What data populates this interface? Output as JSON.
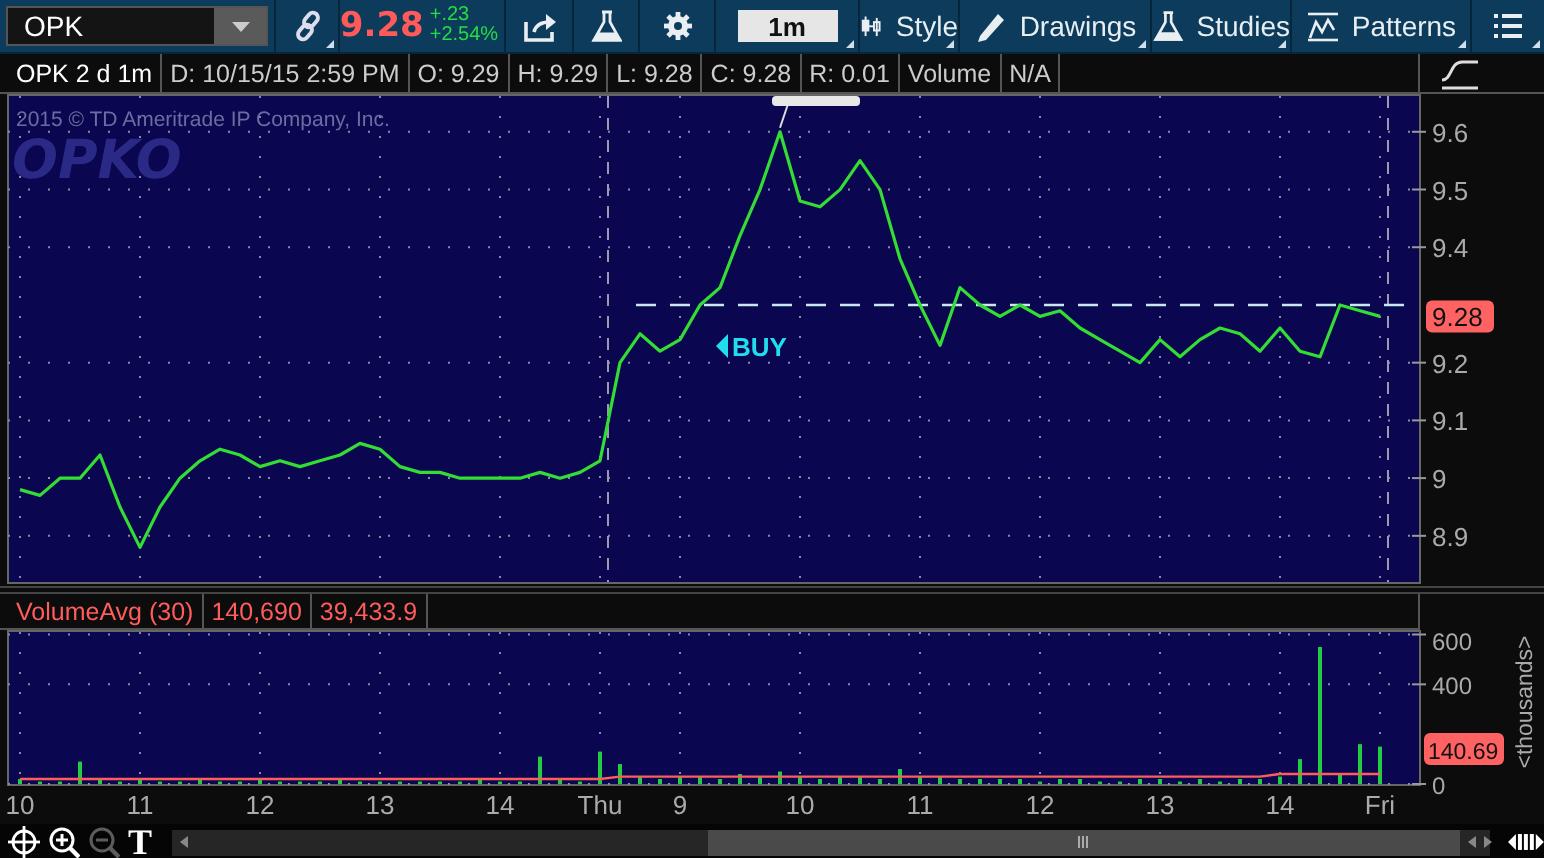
{
  "toolbar": {
    "symbol": "OPK",
    "last_price": "9.28",
    "change": "+.23",
    "change_percent": "+2.54%",
    "timeframe": "1m",
    "menus": [
      {
        "kind": "style",
        "label": "Style"
      },
      {
        "kind": "drawings",
        "label": "Drawings"
      },
      {
        "kind": "studies",
        "label": "Studies"
      },
      {
        "kind": "patterns",
        "label": "Patterns"
      }
    ]
  },
  "info_bar": {
    "cells": [
      "OPK 2 d 1m",
      "D: 10/15/15 2:59 PM",
      "O: 9.29",
      "H: 9.29",
      "L: 9.28",
      "C: 9.28",
      "R: 0.01",
      "Volume",
      "N/A"
    ]
  },
  "price_chart": {
    "copyright": "2015 © TD Ameritrade IP Company, Inc.",
    "logo": "OPKO",
    "price_badge": "9.28",
    "buy_signal": "BUY",
    "chart_data": {
      "type": "line",
      "grid": true,
      "categories": [
        null,
        null,
        null,
        null,
        null,
        null,
        null,
        null,
        null,
        null,
        null,
        null,
        null,
        null,
        null,
        null,
        null,
        null,
        null,
        null,
        null,
        null,
        null,
        null,
        null,
        null,
        null,
        null,
        null,
        null,
        null,
        null,
        null,
        null,
        null,
        null,
        null,
        null,
        null,
        null,
        null,
        null,
        null,
        null,
        null,
        null,
        null,
        null,
        null,
        null,
        null,
        null,
        null,
        null,
        null,
        null,
        null,
        null,
        null,
        null,
        null,
        null,
        null,
        null,
        null,
        null,
        null,
        null,
        null,
        null
      ],
      "series": [
        {
          "color": "#33dd33",
          "values": [
            8.98,
            8.97,
            9.0,
            9.0,
            9.04,
            8.95,
            8.88,
            8.95,
            9.0,
            9.03,
            9.05,
            9.04,
            9.02,
            9.03,
            9.02,
            9.03,
            9.04,
            9.06,
            9.05,
            9.02,
            9.01,
            9.01,
            9.0,
            9.0,
            9.0,
            9.0,
            9.01,
            9.0,
            9.01,
            9.03,
            9.2,
            9.25,
            9.22,
            9.24,
            9.3,
            9.33,
            9.42,
            9.5,
            9.6,
            9.48,
            9.47,
            9.5,
            9.55,
            9.5,
            9.38,
            9.3,
            9.23,
            9.33,
            9.3,
            9.28,
            9.3,
            9.28,
            9.29,
            9.26,
            9.24,
            9.22,
            9.2,
            9.24,
            9.21,
            9.24,
            9.26,
            9.25,
            9.22,
            9.26,
            9.22,
            9.21,
            9.3,
            9.29,
            9.28,
            null
          ]
        }
      ],
      "ylim": [
        8.82,
        9.662
      ],
      "yticks": [
        8.9,
        9,
        9.1,
        9.2,
        9.4,
        9.5,
        9.6
      ],
      "ref_lines": [
        {
          "axis": "y",
          "value": 9.3
        }
      ]
    }
  },
  "volume_study": {
    "cells": [
      "140,690",
      "39,433.9"
    ],
    "value_badge": "140.69",
    "axis_unit": "<thousands>",
    "chart_data": {
      "type": "bar",
      "categories": [
        "10",
        null,
        null,
        null,
        null,
        null,
        "11",
        null,
        null,
        null,
        null,
        null,
        "12",
        null,
        null,
        null,
        null,
        null,
        "13",
        null,
        null,
        null,
        null,
        null,
        "14",
        null,
        null,
        null,
        null,
        "Thu",
        null,
        null,
        null,
        "9",
        null,
        null,
        null,
        null,
        null,
        "10",
        null,
        null,
        null,
        null,
        null,
        "11",
        null,
        null,
        null,
        null,
        null,
        "12",
        null,
        null,
        null,
        null,
        null,
        "13",
        null,
        null,
        null,
        null,
        null,
        "14",
        null,
        null,
        null,
        null,
        "Fri",
        null
      ],
      "series": [
        {
          "type": "bar",
          "color": "#22cc44",
          "values": [
            20,
            10,
            10,
            90,
            20,
            10,
            20,
            10,
            10,
            20,
            10,
            10,
            20,
            10,
            10,
            10,
            20,
            10,
            10,
            10,
            10,
            10,
            10,
            20,
            10,
            10,
            110,
            20,
            10,
            130,
            80,
            30,
            20,
            30,
            30,
            20,
            40,
            30,
            50,
            30,
            20,
            30,
            30,
            20,
            60,
            30,
            30,
            20,
            20,
            20,
            20,
            10,
            20,
            20,
            10,
            10,
            20,
            20,
            10,
            20,
            10,
            20,
            20,
            30,
            100,
            550,
            40,
            160,
            150,
            null
          ]
        },
        {
          "name": "VolumeAvg (30)",
          "type": "line",
          "color": "#ff5c5c",
          "values": [
            20,
            20,
            20,
            20,
            20,
            20,
            20,
            20,
            20,
            20,
            20,
            20,
            20,
            20,
            20,
            20,
            20,
            20,
            20,
            20,
            20,
            20,
            20,
            20,
            20,
            20,
            20,
            20,
            20,
            20,
            30,
            30,
            30,
            30,
            30,
            30,
            30,
            30,
            30,
            30,
            30,
            30,
            30,
            30,
            30,
            30,
            30,
            30,
            30,
            30,
            30,
            30,
            30,
            30,
            30,
            30,
            30,
            30,
            30,
            30,
            30,
            30,
            30,
            40,
            40,
            40,
            40,
            40,
            40,
            null
          ]
        }
      ],
      "grid": true,
      "ylim": [
        0,
        610
      ],
      "yticks": [
        0,
        400,
        600
      ]
    }
  },
  "bottom_tools": [
    {
      "kind": "crosshair",
      "disabled": false
    },
    {
      "kind": "zoom_in",
      "disabled": false
    },
    {
      "kind": "zoom_out",
      "disabled": true
    },
    {
      "kind": "text",
      "label": "T",
      "disabled": false
    }
  ]
}
